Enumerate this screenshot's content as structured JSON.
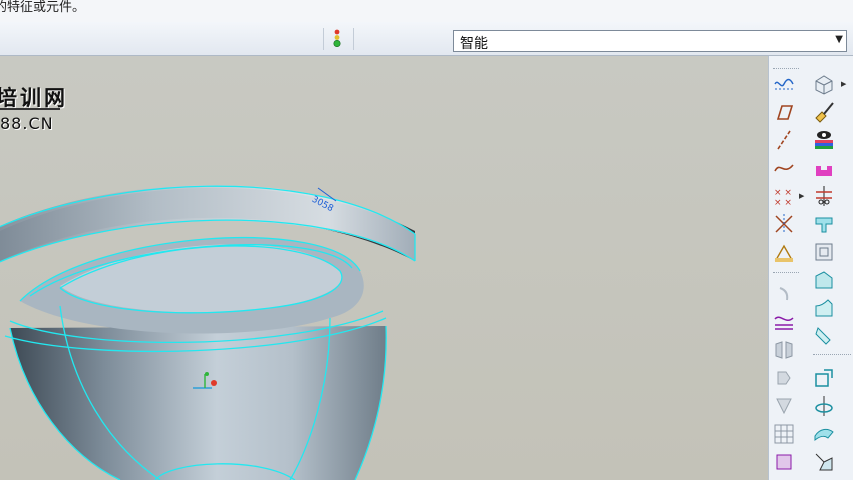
{
  "message_bar": {
    "text": "的特征或元件。"
  },
  "status_bar": {
    "filter_value": "智能"
  },
  "watermark": {
    "line1": "培训网",
    "line2": "88.CN"
  },
  "icons": {
    "traffic_light": "traffic-light-icon",
    "right_toolbar": [
      "datum-plane-display-icon",
      "view-orient-icon",
      "sketch-plane-icon",
      "paint-icon",
      "datum-axis-icon",
      "appearance-icon",
      "datum-curve-icon",
      "extrude-icon",
      "datum-points-icon",
      "revolve-icon",
      "coordinate-system-icon",
      "shell-icon",
      "sketch-icon",
      "draft-icon",
      "round-icon",
      "chamfer-icon",
      "hole-icon",
      "pattern-icon",
      "mirror-icon",
      "merge-icon",
      "trim-icon",
      "offset-icon",
      "extend-icon",
      "rib-icon",
      "fill-icon",
      "warp-icon",
      "project-icon",
      "intersect-icon"
    ]
  },
  "colors": {
    "edge_highlight": "#22e8f0",
    "model_body": "#9aa9b7",
    "viewport_bg": "#c6c6bd"
  }
}
